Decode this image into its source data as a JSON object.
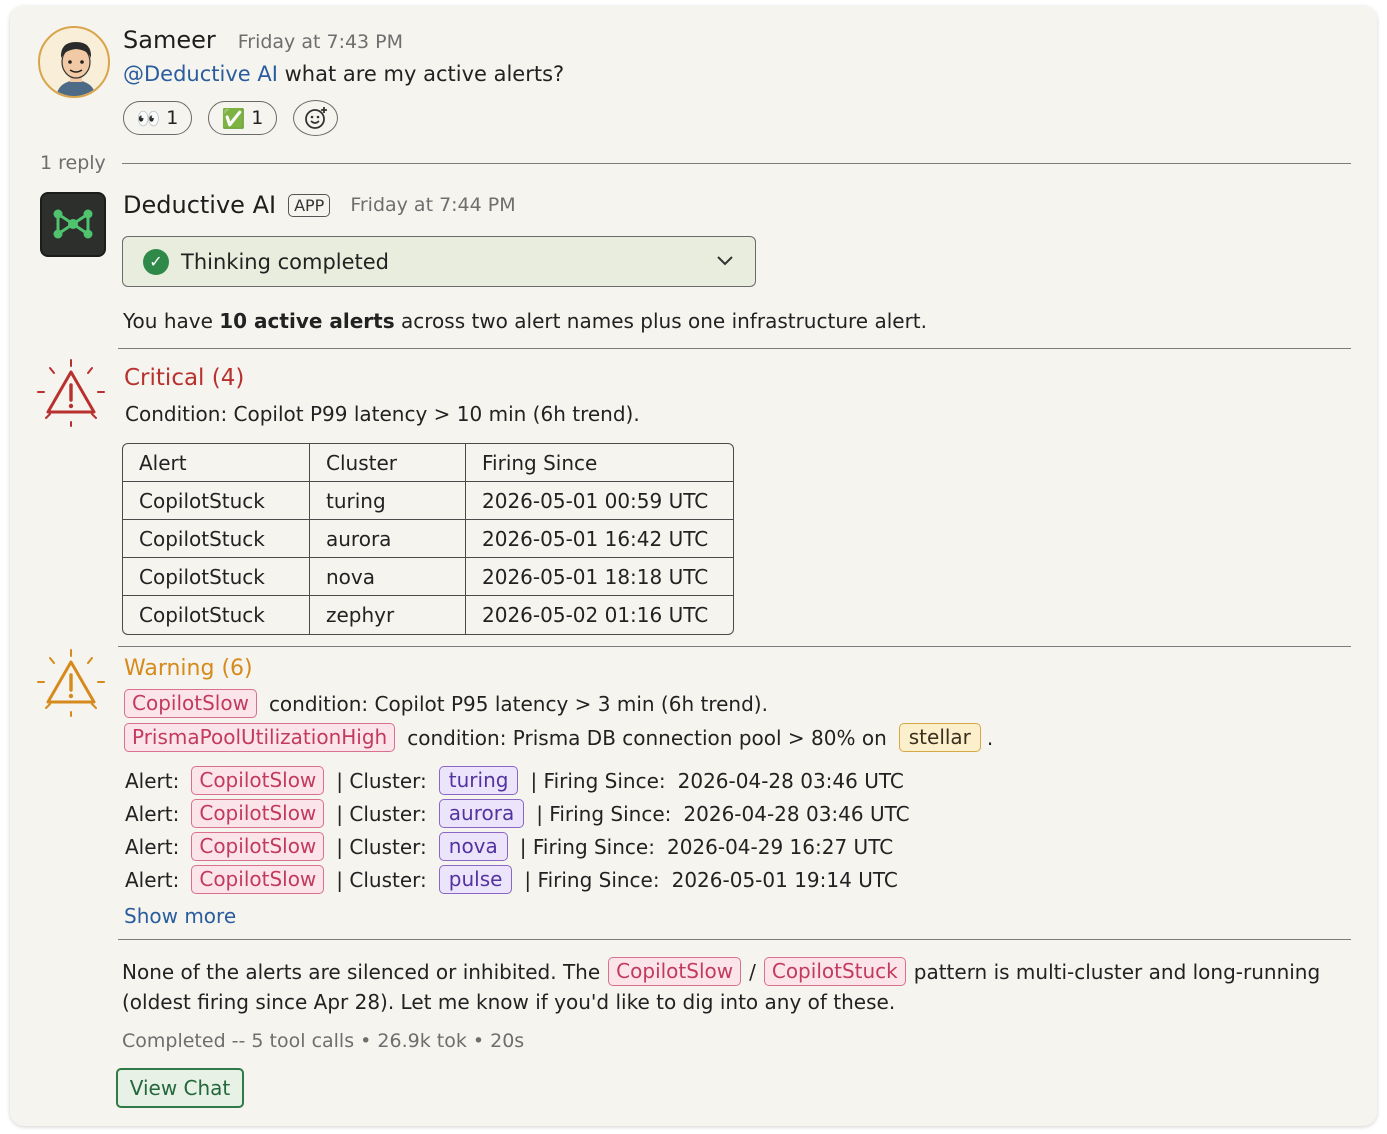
{
  "user_message": {
    "author": "Sameer",
    "timestamp": "Friday at 7:43 PM",
    "mention": "@Deductive AI",
    "text": "what are my active alerts?",
    "reactions": [
      {
        "emoji": "👀",
        "count": "1"
      },
      {
        "emoji": "✅",
        "count": "1"
      }
    ]
  },
  "thread": {
    "reply_count": "1 reply"
  },
  "bot_message": {
    "author": "Deductive AI",
    "badge": "APP",
    "timestamp": "Friday at 7:44 PM",
    "thinking_label": "Thinking completed",
    "summary_pre": "You have ",
    "summary_bold": "10 active alerts",
    "summary_post": " across two alert names plus one infrastructure alert."
  },
  "critical": {
    "title": "Critical (4)",
    "condition": "Condition: Copilot P99 latency > 10 min (6h trend).",
    "table": {
      "headers": [
        "Alert",
        "Cluster",
        "Firing Since"
      ],
      "rows": [
        [
          "CopilotStuck",
          "turing",
          "2026-05-01 00:59 UTC"
        ],
        [
          "CopilotStuck",
          "aurora",
          "2026-05-01 16:42 UTC"
        ],
        [
          "CopilotStuck",
          "nova",
          "2026-05-01 18:18 UTC"
        ],
        [
          "CopilotStuck",
          "zephyr",
          "2026-05-02 01:16 UTC"
        ]
      ]
    }
  },
  "warning": {
    "title": "Warning (6)",
    "cond1_tag": "CopilotSlow",
    "cond1_text": "condition: Copilot P95 latency > 3 min (6h trend).",
    "cond2_tag": "PrismaPoolUtilizationHigh",
    "cond2_text": "condition: Prisma DB connection pool > 80% on",
    "cond2_cluster": "stellar",
    "cond2_end": ".",
    "alert_label": "Alert:",
    "cluster_label": "| Cluster:",
    "since_label": "| Firing Since:",
    "rows": [
      {
        "alert": "CopilotSlow",
        "cluster": "turing",
        "since": "2026-04-28 03:46 UTC"
      },
      {
        "alert": "CopilotSlow",
        "cluster": "aurora",
        "since": "2026-04-28 03:46 UTC"
      },
      {
        "alert": "CopilotSlow",
        "cluster": "nova",
        "since": "2026-04-29 16:27 UTC"
      },
      {
        "alert": "CopilotSlow",
        "cluster": "pulse",
        "since": "2026-05-01 19:14 UTC"
      }
    ],
    "show_more": "Show more"
  },
  "footer": {
    "line1_pre": "None of the alerts are silenced or inhibited. The",
    "tag_a": "CopilotSlow",
    "slash": "/",
    "tag_b": "CopilotStuck",
    "line1_post": "pattern is multi-cluster and long-running",
    "line2": "(oldest firing since Apr 28). Let me know if you'd like to dig into any of these.",
    "meta": "Completed -- 5 tool calls • 26.9k tok • 20s",
    "view_chat": "View Chat"
  },
  "colors": {
    "critical": "#b8312f",
    "warning": "#d68a1c",
    "link": "#2a5d9e",
    "success": "#2f8a4a"
  }
}
